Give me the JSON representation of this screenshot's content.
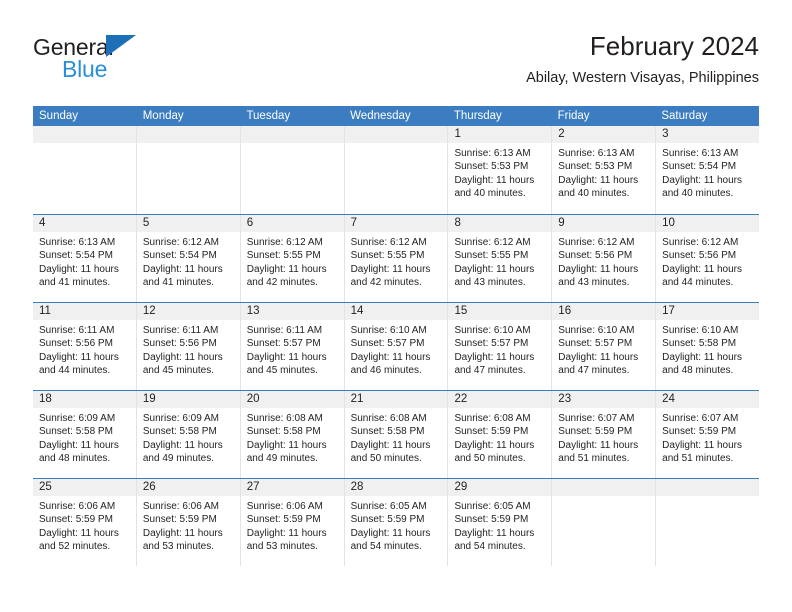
{
  "brand": {
    "name_top": "General",
    "name_bottom": "Blue",
    "accent_color": "#2b8fd6",
    "triangle_color": "#1d6fb8"
  },
  "header": {
    "title": "February 2024",
    "subtitle": "Abilay, Western Visayas, Philippines"
  },
  "theme": {
    "header_row_bg": "#3b7dc0",
    "daynum_bg": "#f0f0f0",
    "cell_bg": "#ffffff",
    "text_color": "#231f20",
    "grid_line": "#e3e3e3"
  },
  "day_headers": [
    "Sunday",
    "Monday",
    "Tuesday",
    "Wednesday",
    "Thursday",
    "Friday",
    "Saturday"
  ],
  "labels": {
    "sunrise_prefix": "Sunrise:",
    "sunset_prefix": "Sunset:",
    "daylight_prefix": "Daylight:"
  },
  "weeks": [
    [
      {
        "day": "",
        "sunrise": "",
        "sunset": "",
        "daylight_line1": "",
        "daylight_line2": ""
      },
      {
        "day": "",
        "sunrise": "",
        "sunset": "",
        "daylight_line1": "",
        "daylight_line2": ""
      },
      {
        "day": "",
        "sunrise": "",
        "sunset": "",
        "daylight_line1": "",
        "daylight_line2": ""
      },
      {
        "day": "",
        "sunrise": "",
        "sunset": "",
        "daylight_line1": "",
        "daylight_line2": ""
      },
      {
        "day": "1",
        "sunrise": "Sunrise: 6:13 AM",
        "sunset": "Sunset: 5:53 PM",
        "daylight_line1": "Daylight: 11 hours",
        "daylight_line2": "and 40 minutes."
      },
      {
        "day": "2",
        "sunrise": "Sunrise: 6:13 AM",
        "sunset": "Sunset: 5:53 PM",
        "daylight_line1": "Daylight: 11 hours",
        "daylight_line2": "and 40 minutes."
      },
      {
        "day": "3",
        "sunrise": "Sunrise: 6:13 AM",
        "sunset": "Sunset: 5:54 PM",
        "daylight_line1": "Daylight: 11 hours",
        "daylight_line2": "and 40 minutes."
      }
    ],
    [
      {
        "day": "4",
        "sunrise": "Sunrise: 6:13 AM",
        "sunset": "Sunset: 5:54 PM",
        "daylight_line1": "Daylight: 11 hours",
        "daylight_line2": "and 41 minutes."
      },
      {
        "day": "5",
        "sunrise": "Sunrise: 6:12 AM",
        "sunset": "Sunset: 5:54 PM",
        "daylight_line1": "Daylight: 11 hours",
        "daylight_line2": "and 41 minutes."
      },
      {
        "day": "6",
        "sunrise": "Sunrise: 6:12 AM",
        "sunset": "Sunset: 5:55 PM",
        "daylight_line1": "Daylight: 11 hours",
        "daylight_line2": "and 42 minutes."
      },
      {
        "day": "7",
        "sunrise": "Sunrise: 6:12 AM",
        "sunset": "Sunset: 5:55 PM",
        "daylight_line1": "Daylight: 11 hours",
        "daylight_line2": "and 42 minutes."
      },
      {
        "day": "8",
        "sunrise": "Sunrise: 6:12 AM",
        "sunset": "Sunset: 5:55 PM",
        "daylight_line1": "Daylight: 11 hours",
        "daylight_line2": "and 43 minutes."
      },
      {
        "day": "9",
        "sunrise": "Sunrise: 6:12 AM",
        "sunset": "Sunset: 5:56 PM",
        "daylight_line1": "Daylight: 11 hours",
        "daylight_line2": "and 43 minutes."
      },
      {
        "day": "10",
        "sunrise": "Sunrise: 6:12 AM",
        "sunset": "Sunset: 5:56 PM",
        "daylight_line1": "Daylight: 11 hours",
        "daylight_line2": "and 44 minutes."
      }
    ],
    [
      {
        "day": "11",
        "sunrise": "Sunrise: 6:11 AM",
        "sunset": "Sunset: 5:56 PM",
        "daylight_line1": "Daylight: 11 hours",
        "daylight_line2": "and 44 minutes."
      },
      {
        "day": "12",
        "sunrise": "Sunrise: 6:11 AM",
        "sunset": "Sunset: 5:56 PM",
        "daylight_line1": "Daylight: 11 hours",
        "daylight_line2": "and 45 minutes."
      },
      {
        "day": "13",
        "sunrise": "Sunrise: 6:11 AM",
        "sunset": "Sunset: 5:57 PM",
        "daylight_line1": "Daylight: 11 hours",
        "daylight_line2": "and 45 minutes."
      },
      {
        "day": "14",
        "sunrise": "Sunrise: 6:10 AM",
        "sunset": "Sunset: 5:57 PM",
        "daylight_line1": "Daylight: 11 hours",
        "daylight_line2": "and 46 minutes."
      },
      {
        "day": "15",
        "sunrise": "Sunrise: 6:10 AM",
        "sunset": "Sunset: 5:57 PM",
        "daylight_line1": "Daylight: 11 hours",
        "daylight_line2": "and 47 minutes."
      },
      {
        "day": "16",
        "sunrise": "Sunrise: 6:10 AM",
        "sunset": "Sunset: 5:57 PM",
        "daylight_line1": "Daylight: 11 hours",
        "daylight_line2": "and 47 minutes."
      },
      {
        "day": "17",
        "sunrise": "Sunrise: 6:10 AM",
        "sunset": "Sunset: 5:58 PM",
        "daylight_line1": "Daylight: 11 hours",
        "daylight_line2": "and 48 minutes."
      }
    ],
    [
      {
        "day": "18",
        "sunrise": "Sunrise: 6:09 AM",
        "sunset": "Sunset: 5:58 PM",
        "daylight_line1": "Daylight: 11 hours",
        "daylight_line2": "and 48 minutes."
      },
      {
        "day": "19",
        "sunrise": "Sunrise: 6:09 AM",
        "sunset": "Sunset: 5:58 PM",
        "daylight_line1": "Daylight: 11 hours",
        "daylight_line2": "and 49 minutes."
      },
      {
        "day": "20",
        "sunrise": "Sunrise: 6:08 AM",
        "sunset": "Sunset: 5:58 PM",
        "daylight_line1": "Daylight: 11 hours",
        "daylight_line2": "and 49 minutes."
      },
      {
        "day": "21",
        "sunrise": "Sunrise: 6:08 AM",
        "sunset": "Sunset: 5:58 PM",
        "daylight_line1": "Daylight: 11 hours",
        "daylight_line2": "and 50 minutes."
      },
      {
        "day": "22",
        "sunrise": "Sunrise: 6:08 AM",
        "sunset": "Sunset: 5:59 PM",
        "daylight_line1": "Daylight: 11 hours",
        "daylight_line2": "and 50 minutes."
      },
      {
        "day": "23",
        "sunrise": "Sunrise: 6:07 AM",
        "sunset": "Sunset: 5:59 PM",
        "daylight_line1": "Daylight: 11 hours",
        "daylight_line2": "and 51 minutes."
      },
      {
        "day": "24",
        "sunrise": "Sunrise: 6:07 AM",
        "sunset": "Sunset: 5:59 PM",
        "daylight_line1": "Daylight: 11 hours",
        "daylight_line2": "and 51 minutes."
      }
    ],
    [
      {
        "day": "25",
        "sunrise": "Sunrise: 6:06 AM",
        "sunset": "Sunset: 5:59 PM",
        "daylight_line1": "Daylight: 11 hours",
        "daylight_line2": "and 52 minutes."
      },
      {
        "day": "26",
        "sunrise": "Sunrise: 6:06 AM",
        "sunset": "Sunset: 5:59 PM",
        "daylight_line1": "Daylight: 11 hours",
        "daylight_line2": "and 53 minutes."
      },
      {
        "day": "27",
        "sunrise": "Sunrise: 6:06 AM",
        "sunset": "Sunset: 5:59 PM",
        "daylight_line1": "Daylight: 11 hours",
        "daylight_line2": "and 53 minutes."
      },
      {
        "day": "28",
        "sunrise": "Sunrise: 6:05 AM",
        "sunset": "Sunset: 5:59 PM",
        "daylight_line1": "Daylight: 11 hours",
        "daylight_line2": "and 54 minutes."
      },
      {
        "day": "29",
        "sunrise": "Sunrise: 6:05 AM",
        "sunset": "Sunset: 5:59 PM",
        "daylight_line1": "Daylight: 11 hours",
        "daylight_line2": "and 54 minutes."
      },
      {
        "day": "",
        "sunrise": "",
        "sunset": "",
        "daylight_line1": "",
        "daylight_line2": ""
      },
      {
        "day": "",
        "sunrise": "",
        "sunset": "",
        "daylight_line1": "",
        "daylight_line2": ""
      }
    ]
  ]
}
